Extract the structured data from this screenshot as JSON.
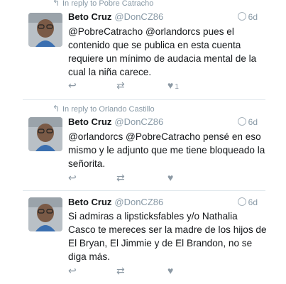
{
  "tweets": [
    {
      "reply_to": "In reply to Pobre Catracho",
      "name": "Beto Cruz",
      "handle": "@DonCZ86",
      "time": "6d",
      "text": "@PobreCatracho @orlandorcs pues el contenido que se publica en esta cuenta requiere un mínimo de audacia mental de la cual la niña carece.",
      "likes": "1"
    },
    {
      "reply_to": "In reply to Orlando Castillo",
      "name": "Beto Cruz",
      "handle": "@DonCZ86",
      "time": "6d",
      "text": "@orlandorcs @PobreCatracho pensé en eso mismo y le adjunto que me tiene bloqueado la señorita.",
      "likes": ""
    },
    {
      "reply_to": "",
      "name": "Beto Cruz",
      "handle": "@DonCZ86",
      "time": "6d",
      "text": "Si admiras a lipsticksfables y/o Nathalia Casco te mereces ser la madre de los hijos de El Bryan, El Jimmie y de El Brandon, no se diga más.",
      "likes": ""
    }
  ],
  "icons": {
    "reply": "reply-icon",
    "retweet": "retweet-icon",
    "like": "heart-icon",
    "privacy": "globe-icon"
  }
}
